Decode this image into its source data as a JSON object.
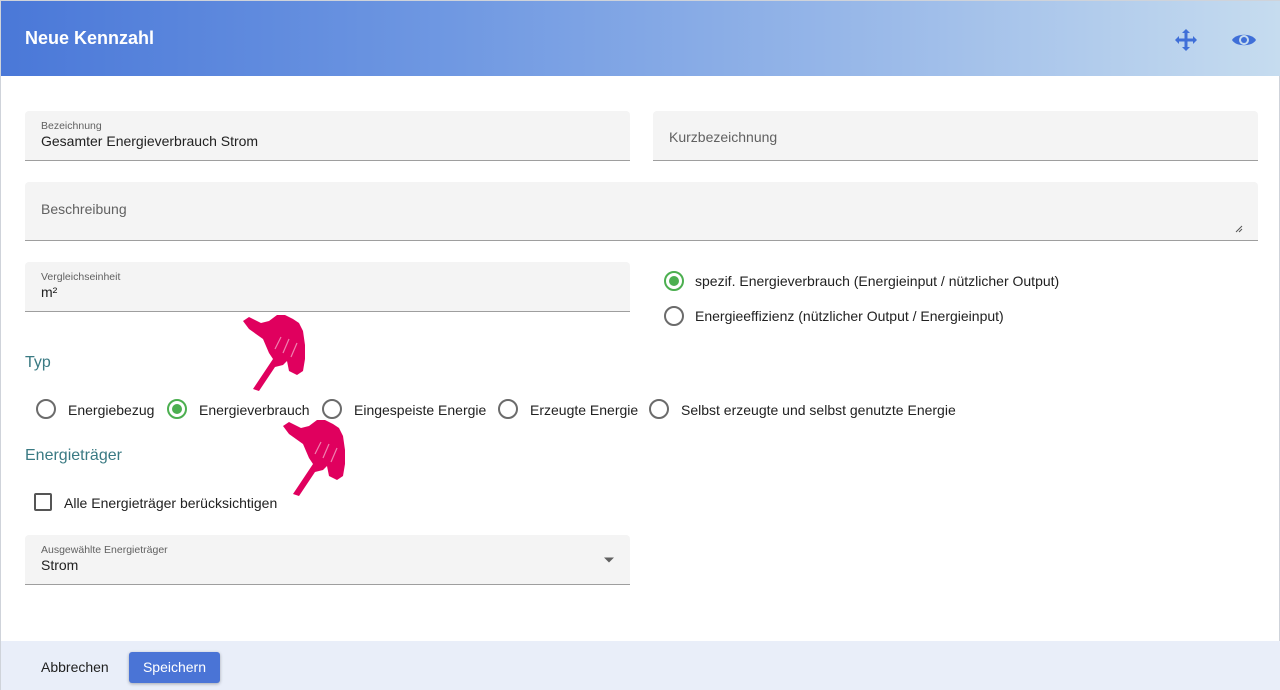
{
  "dialog": {
    "title": "Neue Kennzahl",
    "header_icons": [
      "move-icon",
      "eye-icon"
    ]
  },
  "form": {
    "bezeichnung": {
      "label": "Bezeichnung",
      "value": "Gesamter Energieverbrauch Strom"
    },
    "kurzbezeichnung": {
      "placeholder": "Kurzbezeichnung"
    },
    "beschreibung": {
      "placeholder": "Beschreibung"
    },
    "vergleichseinheit": {
      "label": "Vergleichseinheit",
      "value": "m²"
    },
    "ratio_options": [
      {
        "label": "spezif. Energieverbrauch (Energieinput / nützlicher Output)",
        "selected": true
      },
      {
        "label": "Energieeffizienz (nützlicher Output / Energieinput)",
        "selected": false
      }
    ],
    "typ": {
      "heading": "Typ",
      "options": [
        {
          "label": "Energiebezug",
          "selected": false
        },
        {
          "label": "Energieverbrauch",
          "selected": true
        },
        {
          "label": "Eingespeiste Energie",
          "selected": false
        },
        {
          "label": "Erzeugte Energie",
          "selected": false
        },
        {
          "label": "Selbst erzeugte und selbst genutzte Energie",
          "selected": false
        }
      ]
    },
    "energietraeger": {
      "heading": "Energieträger",
      "checkbox_label": "Alle Energieträger berücksichtigen",
      "checkbox_checked": false,
      "select_label": "Ausgewählte Energieträger",
      "select_value": "Strom"
    }
  },
  "footer": {
    "cancel_label": "Abbrechen",
    "save_label": "Speichern"
  },
  "colors": {
    "accent": "#4a74d6",
    "radio_selected": "#4caf50",
    "section_heading": "#3a7a83",
    "pointer_annotation": "#e0005e"
  }
}
